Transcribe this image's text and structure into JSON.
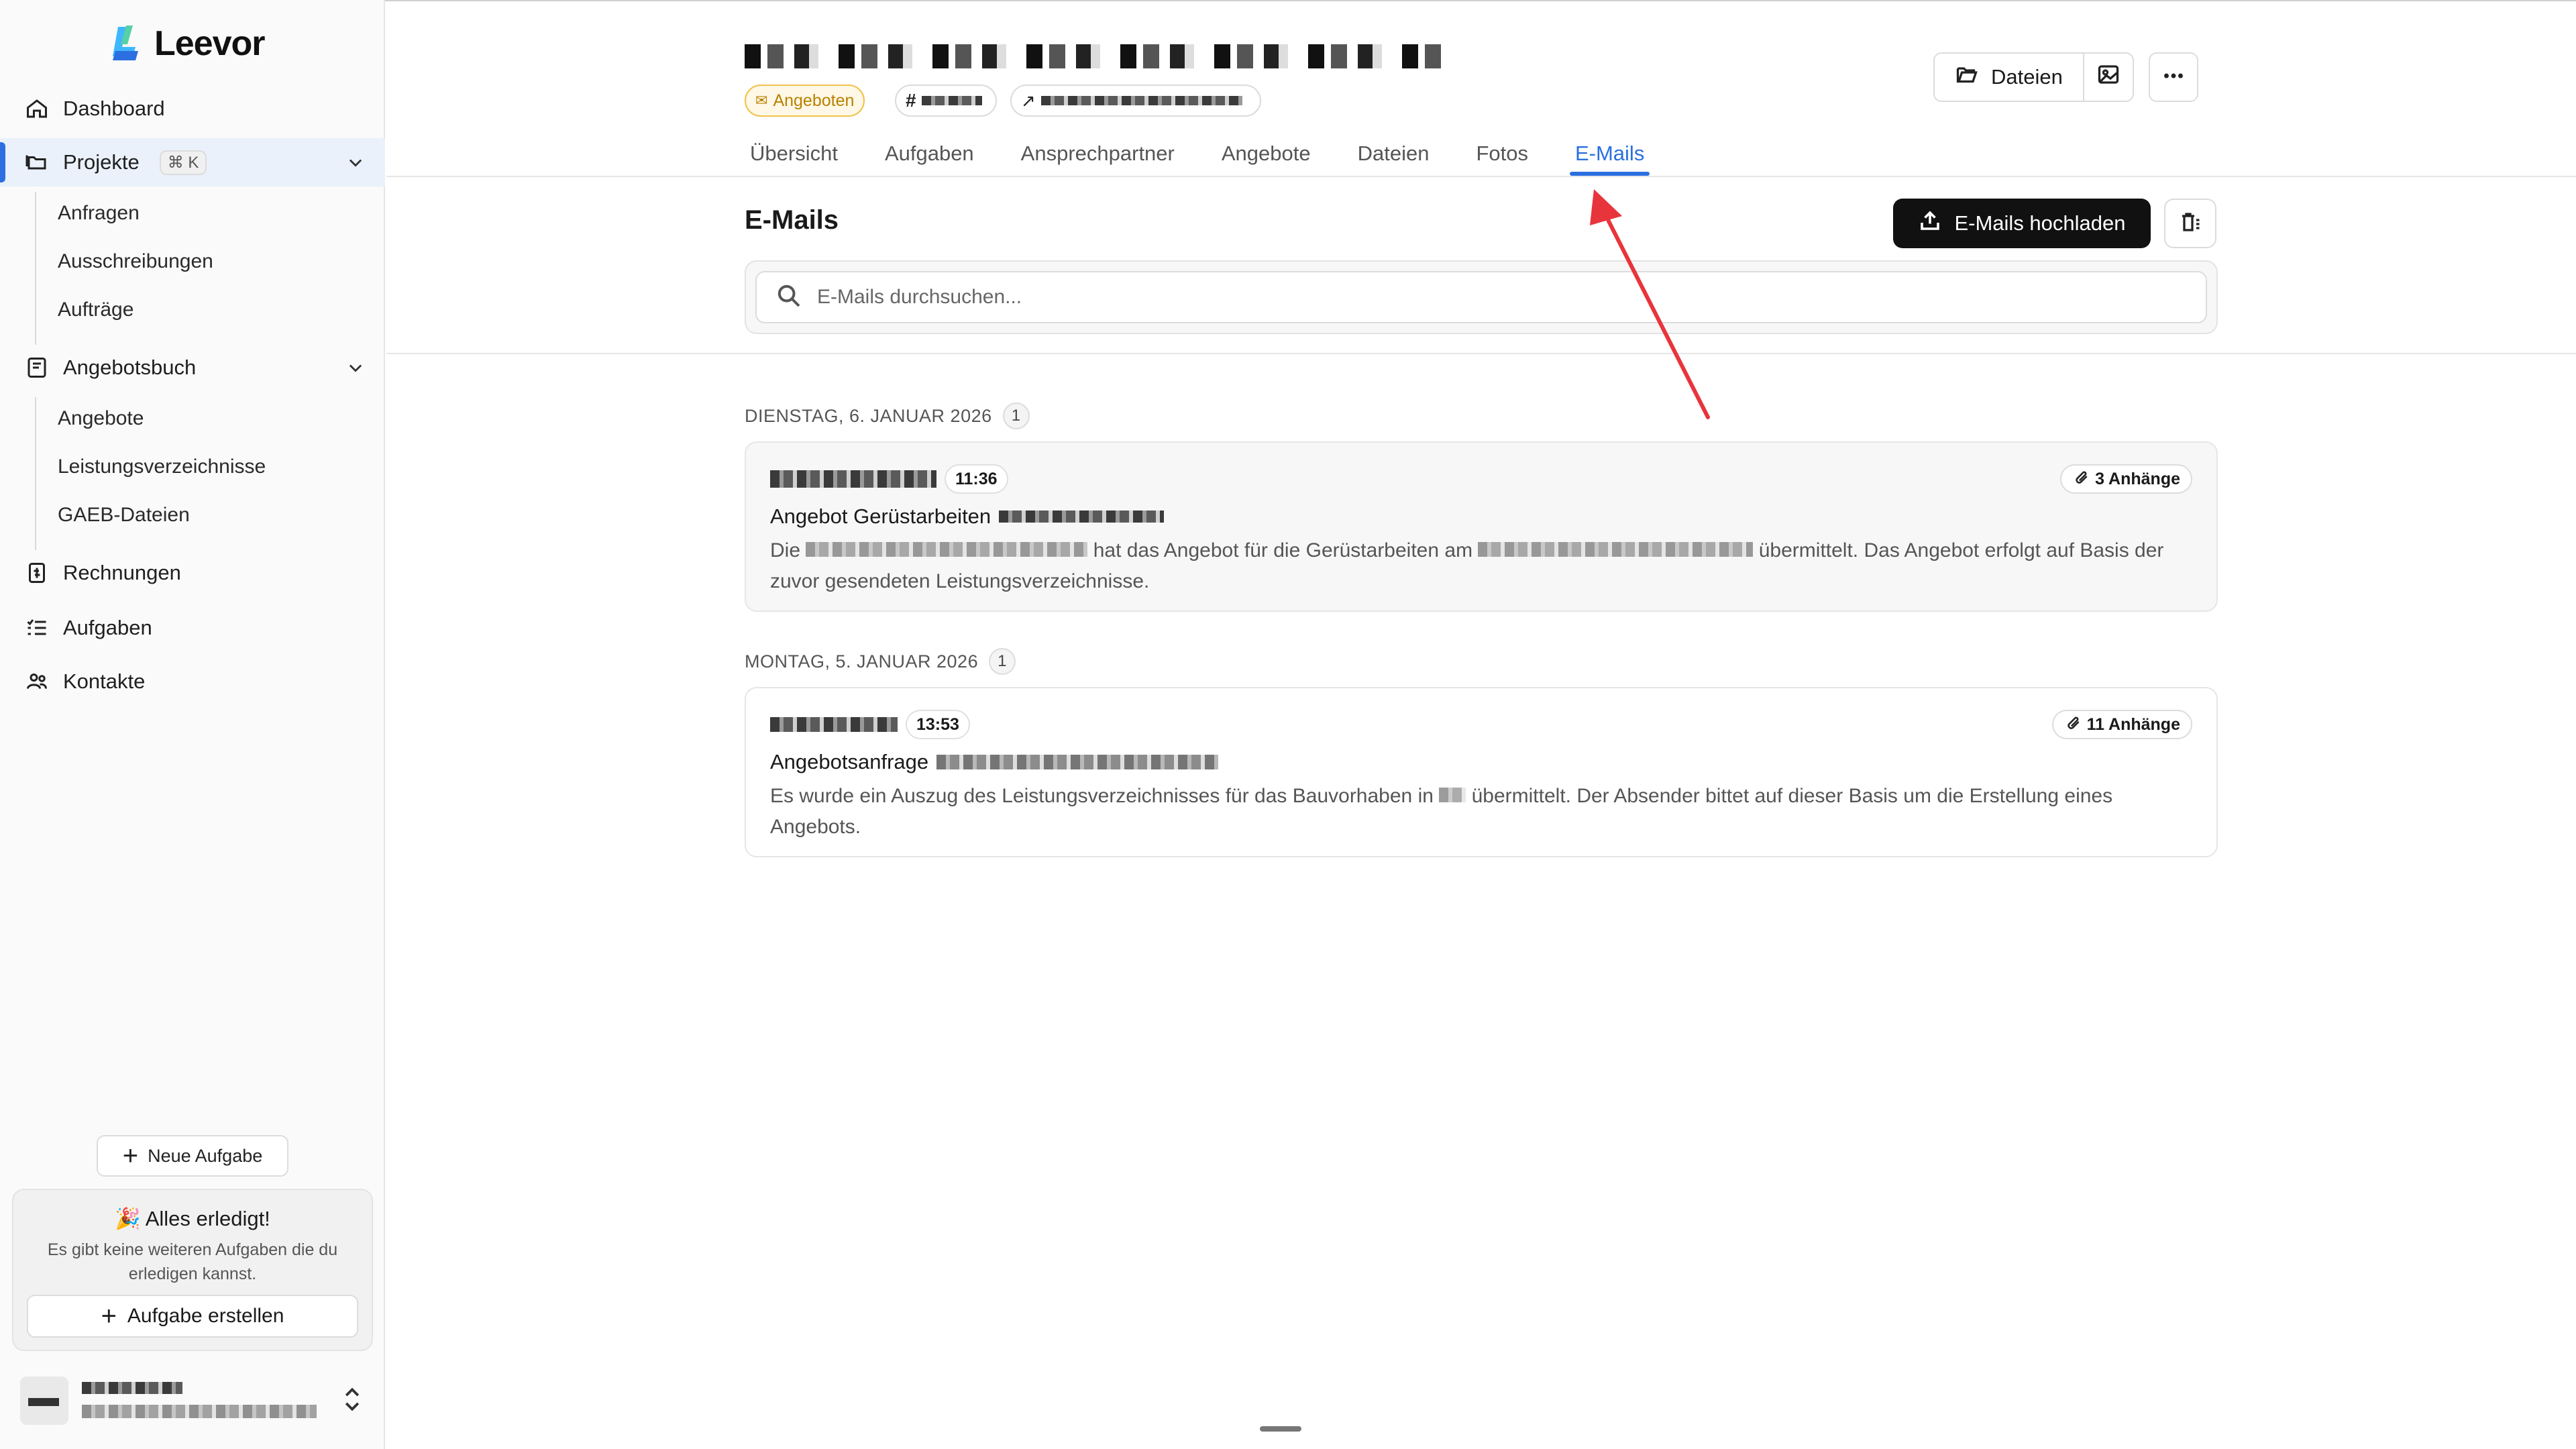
{
  "app": {
    "name": "Leevor"
  },
  "sidebar": {
    "nav": [
      {
        "label": "Dashboard"
      },
      {
        "label": "Projekte",
        "shortcut": "⌘ K"
      },
      {
        "label": "Angebotsbuch"
      },
      {
        "label": "Rechnungen"
      },
      {
        "label": "Aufgaben"
      },
      {
        "label": "Kontakte"
      }
    ],
    "projekte_sub": [
      "Anfragen",
      "Ausschreibungen",
      "Aufträge"
    ],
    "angebotsbuch_sub": [
      "Angebote",
      "Leistungsverzeichnisse",
      "GAEB-Dateien"
    ],
    "new_task_label": "Neue Aufgabe",
    "done_card": {
      "title": "🎉 Alles erledigt!",
      "text": "Es gibt keine weiteren Aufgaben die du erledigen kannst.",
      "button": "Aufgabe erstellen"
    }
  },
  "project": {
    "status_chip": "Angeboten",
    "number_prefix": "#",
    "tabs": [
      "Übersicht",
      "Aufgaben",
      "Ansprechpartner",
      "Angebote",
      "Dateien",
      "Fotos",
      "E-Mails"
    ],
    "active_tab": "E-Mails",
    "files_button": "Dateien"
  },
  "emails": {
    "title": "E-Mails",
    "upload_button": "E-Mails hochladen",
    "search_placeholder": "E-Mails durchsuchen...",
    "groups": [
      {
        "date": "DIENSTAG, 6. JANUAR 2026",
        "count": "1",
        "mail": {
          "time": "11:36",
          "attachments": "3 Anhänge",
          "subject": "Angebot Gerüstarbeiten",
          "body_1": "Die",
          "body_2": "hat das Angebot für die Gerüstarbeiten am",
          "body_3": "übermittelt. Das Angebot erfolgt auf Basis der zuvor gesendeten Leistungsverzeichnisse."
        }
      },
      {
        "date": "MONTAG, 5. JANUAR 2026",
        "count": "1",
        "mail": {
          "time": "13:53",
          "attachments": "11 Anhänge",
          "subject": "Angebotsanfrage",
          "body_1": "Es wurde ein Auszug des Leistungsverzeichnisses für das Bauvorhaben in",
          "body_2": "übermittelt. Der Absender bittet auf dieser Basis um die Erstellung eines Angebots."
        }
      }
    ]
  },
  "colors": {
    "accent": "#2b6fe0",
    "status_chip": "#f0c14a",
    "annotation_arrow": "#e8343b"
  },
  "icons": [
    "home-icon",
    "folders-icon",
    "book-icon",
    "invoice-icon",
    "tasks-icon",
    "contacts-icon",
    "search-icon",
    "upload-icon",
    "trash-icon",
    "paperclip-icon",
    "folder-open-icon",
    "image-icon",
    "more-icon",
    "external-link-icon"
  ]
}
